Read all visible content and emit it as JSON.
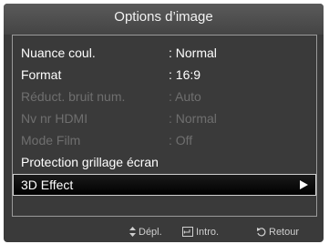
{
  "menu": {
    "title": "Options d’image",
    "items": [
      {
        "label": "Nuance coul.",
        "value": ": Normal"
      },
      {
        "label": "Format",
        "value": ": 16:9"
      },
      {
        "label": "Réduct. bruit num.",
        "value": ": Auto"
      },
      {
        "label": "Nv nr HDMI",
        "value": ": Normal"
      },
      {
        "label": "Mode Film",
        "value": ": Off"
      },
      {
        "label": "Protection grillage écran"
      },
      {
        "label": "3D Effect"
      }
    ]
  },
  "footer": {
    "move": "Dépl.",
    "enter": "Intro.",
    "back": "Retour"
  },
  "colors": {
    "background": "#3a3a3a",
    "text": "#ffffff",
    "disabled_text": "#6f6f6f",
    "selected_bg": "#000000"
  },
  "icons": {
    "move": "updown-arrow-icon",
    "enter": "enter-icon",
    "back": "return-icon",
    "submenu": "triangle-right-icon"
  }
}
